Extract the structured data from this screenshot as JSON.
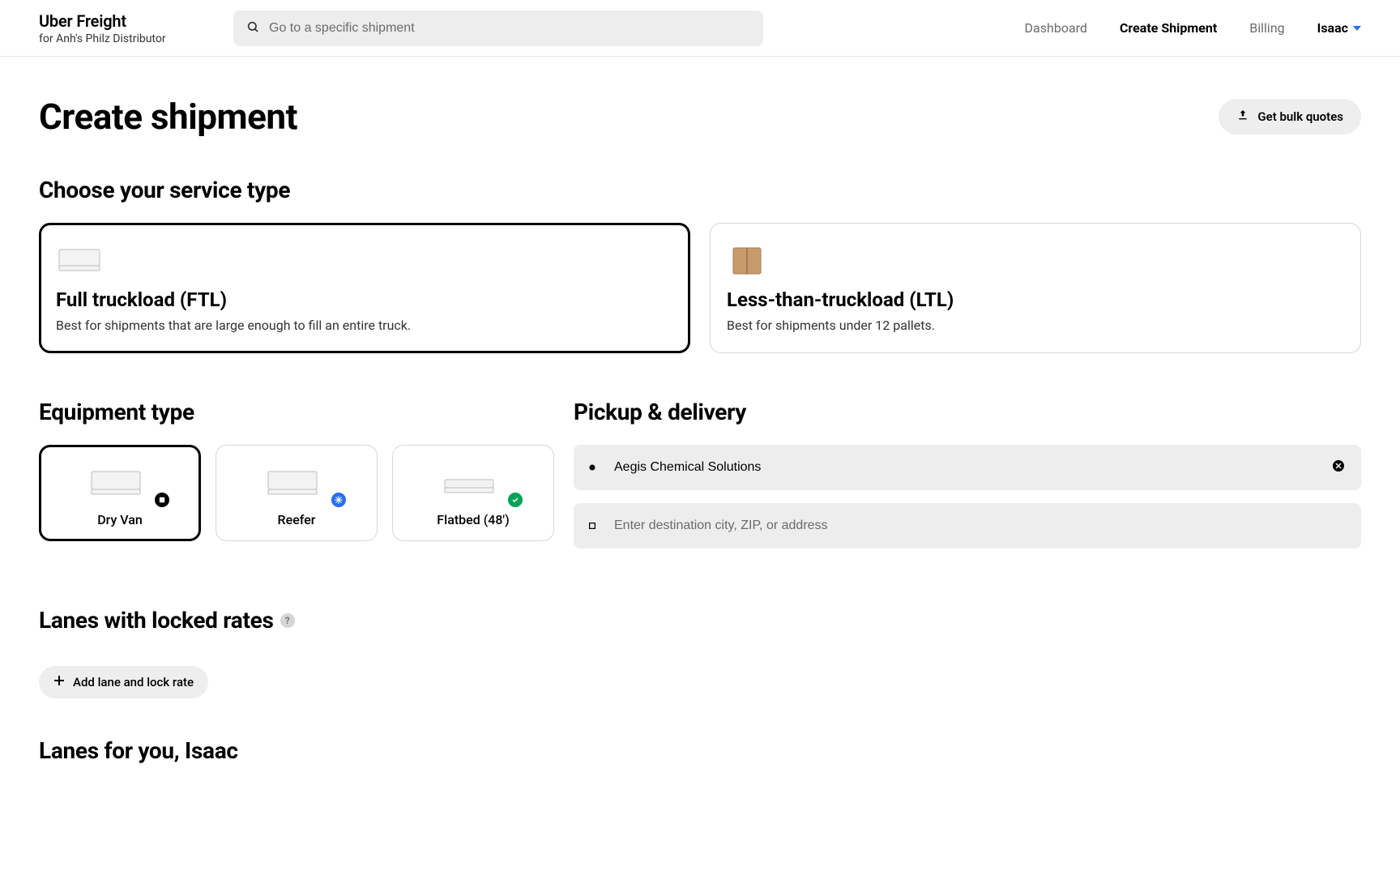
{
  "header": {
    "brand": "Uber Freight",
    "for_prefix": "for  ",
    "company": "Anh's Philz Distributor",
    "search_placeholder": "Go to a specific shipment",
    "nav": {
      "dashboard": "Dashboard",
      "create": "Create Shipment",
      "billing": "Billing"
    },
    "user": "Isaac"
  },
  "page": {
    "title": "Create shipment",
    "bulk_button": "Get bulk quotes"
  },
  "service": {
    "heading": "Choose your service type",
    "ftl": {
      "title": "Full truckload (FTL)",
      "desc": "Best for shipments that are large enough to fill an entire truck."
    },
    "ltl": {
      "title": "Less-than-truckload (LTL)",
      "desc": "Best for shipments under 12 pallets."
    }
  },
  "equipment": {
    "heading": "Equipment type",
    "dry_van": "Dry Van",
    "reefer": "Reefer",
    "flatbed": "Flatbed (48')"
  },
  "pickup": {
    "heading": "Pickup & delivery",
    "origin_value": "Aegis Chemical Solutions",
    "destination_placeholder": "Enter destination city, ZIP, or address"
  },
  "lanes": {
    "locked_heading": "Lanes with locked rates",
    "add_button": "Add lane and lock rate",
    "for_you_heading": "Lanes for you, Isaac"
  }
}
